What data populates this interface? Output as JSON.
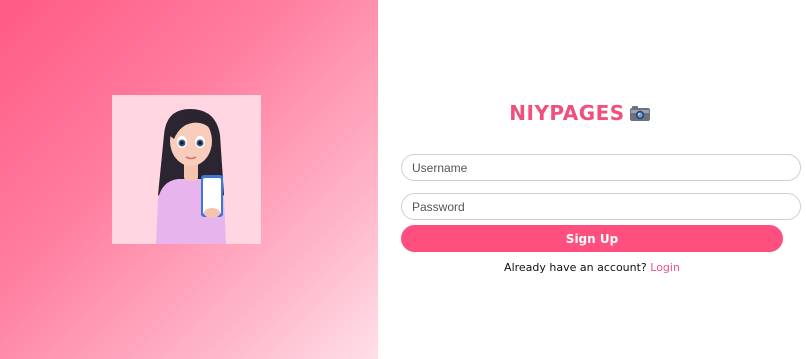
{
  "brand": {
    "title": "NIYPAGES",
    "icon": "camera-icon"
  },
  "form": {
    "username_placeholder": "Username",
    "password_placeholder": "Password",
    "signup_label": "Sign Up"
  },
  "footer": {
    "prompt": "Already have an account?",
    "login_label": "Login"
  },
  "colors": {
    "accent": "#ff4f7f",
    "brand_text": "#f0507e",
    "gradient_start": "#ff5a85",
    "gradient_end": "#ffdfe8"
  },
  "illustration": {
    "icon": "girl-holding-phone-illustration"
  }
}
